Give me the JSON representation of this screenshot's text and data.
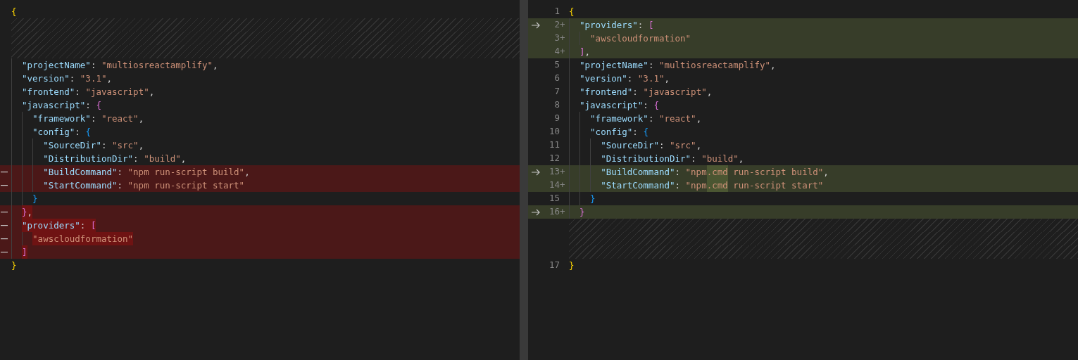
{
  "left_editor": {
    "rows": [
      {
        "kind": "line",
        "removed": false,
        "tokens": [
          {
            "kind": "brace1",
            "text": "{",
            "changed": false
          }
        ]
      },
      {
        "kind": "filler"
      },
      {
        "kind": "filler"
      },
      {
        "kind": "filler"
      },
      {
        "kind": "line",
        "removed": false,
        "tokens": [
          {
            "kind": "key",
            "text": "  \"projectName\"",
            "changed": false
          },
          {
            "kind": "punct",
            "text": ": ",
            "changed": false
          },
          {
            "kind": "string",
            "text": "\"multiosreactamplify\"",
            "changed": false
          },
          {
            "kind": "punct",
            "text": ",",
            "changed": false
          }
        ]
      },
      {
        "kind": "line",
        "removed": false,
        "tokens": [
          {
            "kind": "key",
            "text": "  \"version\"",
            "changed": false
          },
          {
            "kind": "punct",
            "text": ": ",
            "changed": false
          },
          {
            "kind": "string",
            "text": "\"3.1\"",
            "changed": false
          },
          {
            "kind": "punct",
            "text": ",",
            "changed": false
          }
        ]
      },
      {
        "kind": "line",
        "removed": false,
        "tokens": [
          {
            "kind": "key",
            "text": "  \"frontend\"",
            "changed": false
          },
          {
            "kind": "punct",
            "text": ": ",
            "changed": false
          },
          {
            "kind": "string",
            "text": "\"javascript\"",
            "changed": false
          },
          {
            "kind": "punct",
            "text": ",",
            "changed": false
          }
        ]
      },
      {
        "kind": "line",
        "removed": false,
        "tokens": [
          {
            "kind": "key",
            "text": "  \"javascript\"",
            "changed": false
          },
          {
            "kind": "punct",
            "text": ": ",
            "changed": false
          },
          {
            "kind": "brace2",
            "text": "{",
            "changed": false
          }
        ]
      },
      {
        "kind": "line",
        "removed": false,
        "tokens": [
          {
            "kind": "key",
            "text": "    \"framework\"",
            "changed": false
          },
          {
            "kind": "punct",
            "text": ": ",
            "changed": false
          },
          {
            "kind": "string",
            "text": "\"react\"",
            "changed": false
          },
          {
            "kind": "punct",
            "text": ",",
            "changed": false
          }
        ]
      },
      {
        "kind": "line",
        "removed": false,
        "tokens": [
          {
            "kind": "key",
            "text": "    \"config\"",
            "changed": false
          },
          {
            "kind": "punct",
            "text": ": ",
            "changed": false
          },
          {
            "kind": "brace3",
            "text": "{",
            "changed": false
          }
        ]
      },
      {
        "kind": "line",
        "removed": false,
        "tokens": [
          {
            "kind": "key",
            "text": "      \"SourceDir\"",
            "changed": false
          },
          {
            "kind": "punct",
            "text": ": ",
            "changed": false
          },
          {
            "kind": "string",
            "text": "\"src\"",
            "changed": false
          },
          {
            "kind": "punct",
            "text": ",",
            "changed": false
          }
        ]
      },
      {
        "kind": "line",
        "removed": false,
        "tokens": [
          {
            "kind": "key",
            "text": "      \"DistributionDir\"",
            "changed": false
          },
          {
            "kind": "punct",
            "text": ": ",
            "changed": false
          },
          {
            "kind": "string",
            "text": "\"build\"",
            "changed": false
          },
          {
            "kind": "punct",
            "text": ",",
            "changed": false
          }
        ]
      },
      {
        "kind": "line",
        "removed": true,
        "tokens": [
          {
            "kind": "key",
            "text": "      \"BuildCommand\"",
            "changed": false
          },
          {
            "kind": "punct",
            "text": ": ",
            "changed": false
          },
          {
            "kind": "string",
            "text": "\"npm run-script build\"",
            "changed": false
          },
          {
            "kind": "punct",
            "text": ",",
            "changed": false
          }
        ]
      },
      {
        "kind": "line",
        "removed": true,
        "tokens": [
          {
            "kind": "key",
            "text": "      \"StartCommand\"",
            "changed": false
          },
          {
            "kind": "punct",
            "text": ": ",
            "changed": false
          },
          {
            "kind": "string",
            "text": "\"npm run-script start\"",
            "changed": false
          }
        ]
      },
      {
        "kind": "line",
        "removed": false,
        "tokens": [
          {
            "kind": "brace3",
            "text": "    }",
            "changed": false
          }
        ]
      },
      {
        "kind": "line",
        "removed": true,
        "tokens": [
          {
            "kind": "brace2",
            "text": "  }",
            "changed": true
          },
          {
            "kind": "punct",
            "text": ",",
            "changed": true
          }
        ]
      },
      {
        "kind": "line",
        "removed": true,
        "tokens": [
          {
            "kind": "key",
            "text": "  \"providers\"",
            "changed": true
          },
          {
            "kind": "punct",
            "text": ": ",
            "changed": true
          },
          {
            "kind": "brace2",
            "text": "[",
            "changed": true
          }
        ]
      },
      {
        "kind": "line",
        "removed": true,
        "tokens": [
          {
            "kind": "string",
            "text": "    \"awscloudformation\"",
            "changed": true
          }
        ]
      },
      {
        "kind": "line",
        "removed": true,
        "tokens": [
          {
            "kind": "brace2",
            "text": "  ]",
            "changed": true
          }
        ]
      },
      {
        "kind": "line",
        "removed": false,
        "tokens": [
          {
            "kind": "brace1",
            "text": "}",
            "changed": false
          }
        ]
      }
    ]
  },
  "right_editor": {
    "rows": [
      {
        "kind": "line",
        "added": false,
        "revert_arrow": false,
        "number": "1",
        "tokens": [
          {
            "kind": "brace1",
            "text": "{",
            "changed": false
          }
        ]
      },
      {
        "kind": "line",
        "added": true,
        "revert_arrow": true,
        "number": "2",
        "sign": "+",
        "tokens": [
          {
            "kind": "key",
            "text": "  \"providers\"",
            "changed": false
          },
          {
            "kind": "punct",
            "text": ": ",
            "changed": false
          },
          {
            "kind": "brace2",
            "text": "[",
            "changed": false
          }
        ]
      },
      {
        "kind": "line",
        "added": true,
        "revert_arrow": false,
        "number": "3",
        "sign": "+",
        "tokens": [
          {
            "kind": "string",
            "text": "    \"awscloudformation\"",
            "changed": false
          }
        ]
      },
      {
        "kind": "line",
        "added": true,
        "revert_arrow": false,
        "number": "4",
        "sign": "+",
        "tokens": [
          {
            "kind": "brace2",
            "text": "  ]",
            "changed": false
          },
          {
            "kind": "punct",
            "text": ",",
            "changed": false
          }
        ]
      },
      {
        "kind": "line",
        "added": false,
        "revert_arrow": false,
        "number": "5",
        "tokens": [
          {
            "kind": "key",
            "text": "  \"projectName\"",
            "changed": false
          },
          {
            "kind": "punct",
            "text": ": ",
            "changed": false
          },
          {
            "kind": "string",
            "text": "\"multiosreactamplify\"",
            "changed": false
          },
          {
            "kind": "punct",
            "text": ",",
            "changed": false
          }
        ]
      },
      {
        "kind": "line",
        "added": false,
        "revert_arrow": false,
        "number": "6",
        "tokens": [
          {
            "kind": "key",
            "text": "  \"version\"",
            "changed": false
          },
          {
            "kind": "punct",
            "text": ": ",
            "changed": false
          },
          {
            "kind": "string",
            "text": "\"3.1\"",
            "changed": false
          },
          {
            "kind": "punct",
            "text": ",",
            "changed": false
          }
        ]
      },
      {
        "kind": "line",
        "added": false,
        "revert_arrow": false,
        "number": "7",
        "tokens": [
          {
            "kind": "key",
            "text": "  \"frontend\"",
            "changed": false
          },
          {
            "kind": "punct",
            "text": ": ",
            "changed": false
          },
          {
            "kind": "string",
            "text": "\"javascript\"",
            "changed": false
          },
          {
            "kind": "punct",
            "text": ",",
            "changed": false
          }
        ]
      },
      {
        "kind": "line",
        "added": false,
        "revert_arrow": false,
        "number": "8",
        "tokens": [
          {
            "kind": "key",
            "text": "  \"javascript\"",
            "changed": false
          },
          {
            "kind": "punct",
            "text": ": ",
            "changed": false
          },
          {
            "kind": "brace2",
            "text": "{",
            "changed": false
          }
        ]
      },
      {
        "kind": "line",
        "added": false,
        "revert_arrow": false,
        "number": "9",
        "tokens": [
          {
            "kind": "key",
            "text": "    \"framework\"",
            "changed": false
          },
          {
            "kind": "punct",
            "text": ": ",
            "changed": false
          },
          {
            "kind": "string",
            "text": "\"react\"",
            "changed": false
          },
          {
            "kind": "punct",
            "text": ",",
            "changed": false
          }
        ]
      },
      {
        "kind": "line",
        "added": false,
        "revert_arrow": false,
        "number": "10",
        "tokens": [
          {
            "kind": "key",
            "text": "    \"config\"",
            "changed": false
          },
          {
            "kind": "punct",
            "text": ": ",
            "changed": false
          },
          {
            "kind": "brace3",
            "text": "{",
            "changed": false
          }
        ]
      },
      {
        "kind": "line",
        "added": false,
        "revert_arrow": false,
        "number": "11",
        "tokens": [
          {
            "kind": "key",
            "text": "      \"SourceDir\"",
            "changed": false
          },
          {
            "kind": "punct",
            "text": ": ",
            "changed": false
          },
          {
            "kind": "string",
            "text": "\"src\"",
            "changed": false
          },
          {
            "kind": "punct",
            "text": ",",
            "changed": false
          }
        ]
      },
      {
        "kind": "line",
        "added": false,
        "revert_arrow": false,
        "number": "12",
        "tokens": [
          {
            "kind": "key",
            "text": "      \"DistributionDir\"",
            "changed": false
          },
          {
            "kind": "punct",
            "text": ": ",
            "changed": false
          },
          {
            "kind": "string",
            "text": "\"build\"",
            "changed": false
          },
          {
            "kind": "punct",
            "text": ",",
            "changed": false
          }
        ]
      },
      {
        "kind": "line",
        "added": true,
        "revert_arrow": true,
        "number": "13",
        "sign": "+",
        "tokens": [
          {
            "kind": "key",
            "text": "      \"BuildCommand\"",
            "changed": false
          },
          {
            "kind": "punct",
            "text": ": ",
            "changed": false
          },
          {
            "kind": "string",
            "text": "\"npm",
            "changed": false
          },
          {
            "kind": "string",
            "text": ".cmd",
            "changed": true
          },
          {
            "kind": "string",
            "text": " run-script build\"",
            "changed": false
          },
          {
            "kind": "punct",
            "text": ",",
            "changed": false
          }
        ]
      },
      {
        "kind": "line",
        "added": true,
        "revert_arrow": false,
        "number": "14",
        "sign": "+",
        "tokens": [
          {
            "kind": "key",
            "text": "      \"StartCommand\"",
            "changed": false
          },
          {
            "kind": "punct",
            "text": ": ",
            "changed": false
          },
          {
            "kind": "string",
            "text": "\"npm",
            "changed": false
          },
          {
            "kind": "string",
            "text": ".cmd",
            "changed": true
          },
          {
            "kind": "string",
            "text": " run-script start\"",
            "changed": false
          }
        ]
      },
      {
        "kind": "line",
        "added": false,
        "revert_arrow": false,
        "number": "15",
        "tokens": [
          {
            "kind": "brace3",
            "text": "    }",
            "changed": false
          }
        ]
      },
      {
        "kind": "line",
        "added": true,
        "revert_arrow": true,
        "number": "16",
        "sign": "+",
        "tokens": [
          {
            "kind": "brace2",
            "text": "  }",
            "changed": false
          }
        ]
      },
      {
        "kind": "filler"
      },
      {
        "kind": "filler"
      },
      {
        "kind": "filler"
      },
      {
        "kind": "line",
        "added": false,
        "revert_arrow": false,
        "number": "17",
        "tokens": [
          {
            "kind": "brace1",
            "text": "}",
            "changed": false
          }
        ]
      }
    ]
  }
}
